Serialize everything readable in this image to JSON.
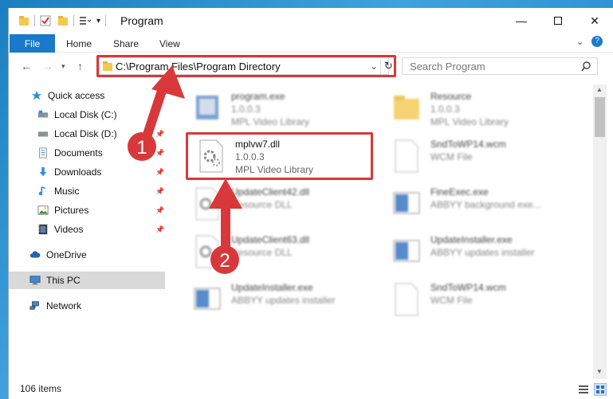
{
  "window": {
    "title": "Program",
    "minimize_icon": "minimize-icon",
    "maximize_icon": "maximize-icon",
    "close_icon": "close-icon"
  },
  "ribbon": {
    "tabs": [
      "File",
      "Home",
      "Share",
      "View"
    ]
  },
  "address": {
    "path": "C:\\Program Files\\Program Directory",
    "search_placeholder": "Search Program"
  },
  "sidebar": {
    "items": [
      {
        "label": "Quick access",
        "icon": "star-icon"
      },
      {
        "label": "Local Disk (C:)",
        "icon": "drive-icon"
      },
      {
        "label": "Local Disk (D:)",
        "icon": "drive-icon"
      },
      {
        "label": "Documents",
        "icon": "documents-icon"
      },
      {
        "label": "Downloads",
        "icon": "download-icon"
      },
      {
        "label": "Music",
        "icon": "music-icon"
      },
      {
        "label": "Pictures",
        "icon": "pictures-icon"
      },
      {
        "label": "Videos",
        "icon": "videos-icon"
      },
      {
        "label": "OneDrive",
        "icon": "cloud-icon"
      },
      {
        "label": "This PC",
        "icon": "computer-icon"
      },
      {
        "label": "Network",
        "icon": "network-icon"
      }
    ]
  },
  "files": [
    {
      "name": "program.exe",
      "line1": "1.0.0.3",
      "line2": "MPL Video Library"
    },
    {
      "name": "Resource",
      "line1": "1.0.0.3",
      "line2": "MPL Video Library"
    },
    {
      "name": "mplvw7.dll",
      "line1": "1.0.0.3",
      "line2": "MPL Video Library"
    },
    {
      "name": "SndToWP14.wcm",
      "line1": "WCM File",
      "line2": ""
    },
    {
      "name": "UpdateClient42.dll",
      "line1": "Resource DLL",
      "line2": ""
    },
    {
      "name": "FineExec.exe",
      "line1": "ABBYY background exe...",
      "line2": ""
    },
    {
      "name": "UpdateClient63.dll",
      "line1": "Resource DLL",
      "line2": ""
    },
    {
      "name": "UpdateInstaller.exe",
      "line1": "ABBYY updates installer",
      "line2": ""
    },
    {
      "name": "UpdateInstaller.exe",
      "line1": "ABBYY updates installer",
      "line2": ""
    },
    {
      "name": "SndToWP14.wcm",
      "line1": "WCM File",
      "line2": ""
    }
  ],
  "status": {
    "item_count": "106 items"
  },
  "annotations": {
    "step1": "1",
    "step2": "2"
  },
  "colors": {
    "accent": "#1979ca",
    "highlight_red": "#d9383a",
    "selected_bg": "#d9d9d9"
  }
}
